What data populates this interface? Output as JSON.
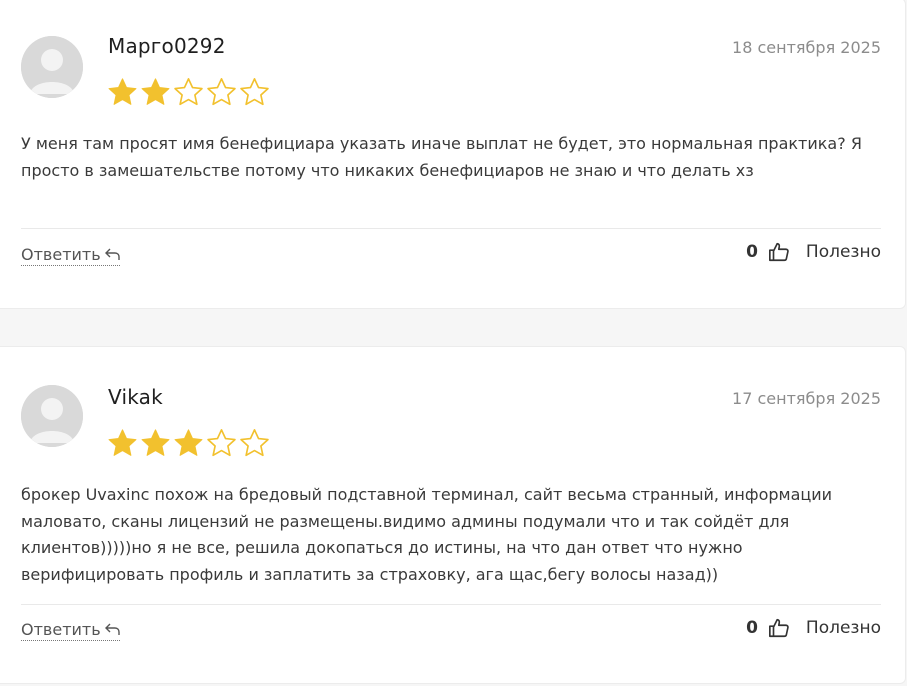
{
  "reviews": [
    {
      "author": "Марго0292",
      "date": "18 сентября 2025",
      "rating": 2,
      "max_rating": 5,
      "text": "У меня там просят имя бенефициара указать иначе выплат не будет, это нормальная практика? Я просто в замешательстве потому что никаких бенефициаров не знаю и что делать хз",
      "reply_label": "Ответить",
      "likes": "0",
      "useful_label": "Полезно"
    },
    {
      "author": "Vikak",
      "date": "17 сентября 2025",
      "rating": 3,
      "max_rating": 5,
      "text": "брокер Uvaxinc похож на бредовый подставной терминал, сайт весьма странный, информации маловато, сканы лицензий не размещены.видимо админы подумали что и так сойдёт для клиентов)))))но я не все, решила докопаться до истины, на что дан ответ что нужно верифицировать профиль и заплатить за страховку, ага щас,бегу волосы назад))",
      "reply_label": "Ответить",
      "likes": "0",
      "useful_label": "Полезно"
    }
  ],
  "icons": {
    "avatar": "user-avatar-icon",
    "star": "star-icon",
    "reply": "reply-arrow-icon",
    "like": "thumbs-up-icon"
  },
  "colors": {
    "star_filled": "#f2c12e",
    "star_outline": "#f2c12e",
    "date": "#8c8c8c",
    "avatar_bg": "#dcdcdc"
  }
}
